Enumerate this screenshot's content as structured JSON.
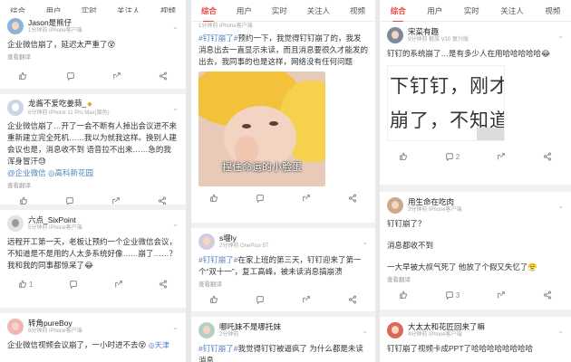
{
  "tabs": [
    "综合",
    "用户",
    "实时",
    "关注人",
    "视频"
  ],
  "translate_label": "查看翻译",
  "colors": {
    "accent": "#e8463f",
    "link": "#4f7fc0"
  },
  "col1": {
    "posts": [
      {
        "user": "Jason是熊仔",
        "sub": "1分钟前 iPhone客户端",
        "text": "企业微信崩了，延迟太严重了",
        "emoji": "😵",
        "actions": {
          "repost": "",
          "comment": "",
          "like": ""
        }
      },
      {
        "user": "龙酱不爱吃姜蒜_",
        "sub": "6分钟前 iPhone 11 Pro Max(银色)",
        "text": "企业微信崩了…开了一会不断有人掉出会议进不来 重新建立完全死机……我以为就我这样。换别人建会议也是，消息收不到 语音拉不出来……急的我浑身冒汗",
        "emoji": "😓",
        "tags": [
          "@企业微信",
          "高科新花园"
        ],
        "actions": {
          "repost": "",
          "comment": "",
          "like": ""
        }
      },
      {
        "user": "六点_SixPoint",
        "sub": "5分钟前 iPhone客户端",
        "text": "远程开工第一天，老板让预约一个企业微信会议，不知道是不是用的人太多系统好像……崩了……？我和我的同事都惊呆了",
        "emoji": "😂",
        "actions": {
          "repost": "1",
          "comment": "",
          "like": ""
        }
      },
      {
        "user": "转角pureBoy",
        "sub": "8分钟前 iPhone客户端",
        "text": "企业微信视频会议崩了，一小时进不去",
        "emoji": "😵",
        "location": "天津"
      }
    ]
  },
  "col2": {
    "posts": [
      {
        "sub": "1分钟前 iPhone客户端",
        "topic": "#钉钉崩了#",
        "text": "预约一下，我觉得钉钉崩了的，我发消息出去一直显示未读，而且消息要很久才能发的出去，我同事的也是这样，网络没有任何问题",
        "image_caption": "捏住命运的小脸蛋",
        "actions": {
          "repost": "",
          "comment": "",
          "like": ""
        }
      },
      {
        "user": "s堰ly",
        "sub": "2分钟前 OnePlus 5T",
        "topic": "#钉钉崩了#",
        "text": "在家上班的第三天，钉钉迎来了第一个“双十一”，复工高峰，被未读消息搞崩溃",
        "actions": {
          "repost": "",
          "comment": "",
          "like": ""
        }
      },
      {
        "user": "哪吒妹不是哪托妹",
        "sub": "2分钟前",
        "topic": "#钉钉崩了#",
        "text": "我觉得钉钉被逼疯了 为什么都是未读消息"
      }
    ]
  },
  "col3": {
    "posts": [
      {
        "user": "宋菜有趣",
        "sub": "9分钟前 魅族 V10 复兴版",
        "text": "钉钉的系统崩了…是有多少人在用哈哈哈哈哈",
        "emoji": "😂",
        "image_lines": [
          "下钉钉，刚才",
          "崩了，不知道"
        ],
        "actions": {
          "repost": "",
          "comment": "2",
          "like": ""
        }
      },
      {
        "user": "用生命在吃肉",
        "sub": "3分钟前 iPhone客户端",
        "lines": [
          "钉钉崩了？",
          "消息都收不到",
          "一大早被大叔气死了 他放了个假又失忆了"
        ],
        "emoji": "😤",
        "actions": {
          "repost": "",
          "comment": "3",
          "like": ""
        }
      },
      {
        "user": "大太太和花匠回来了嘛",
        "sub": "4分钟前 iPhone客户端",
        "text": "钉钉崩了视频卡成PPT了哈哈哈哈哈哈哈哈"
      }
    ]
  }
}
